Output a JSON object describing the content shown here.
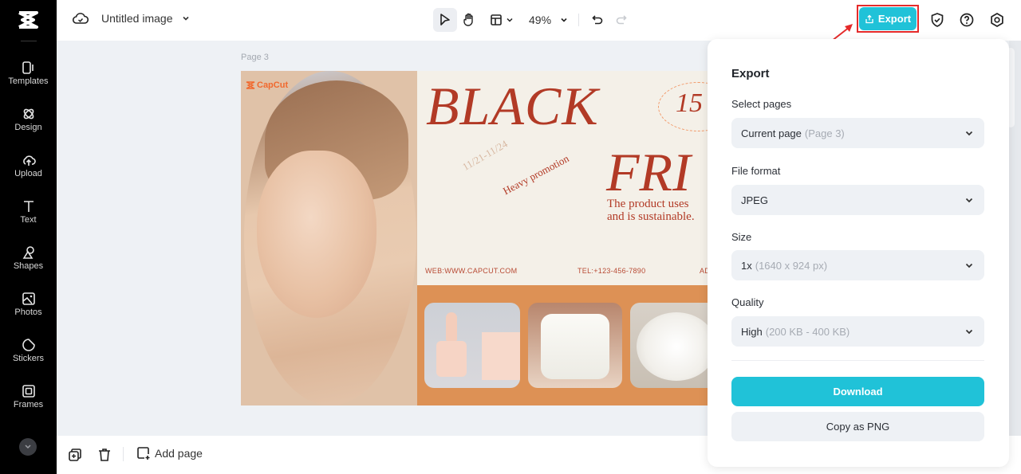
{
  "app": {
    "title": "Untitled image",
    "zoom": "49%"
  },
  "sidebar": {
    "items": [
      {
        "label": "Templates",
        "icon": "templates-icon"
      },
      {
        "label": "Design",
        "icon": "design-icon"
      },
      {
        "label": "Upload",
        "icon": "upload-icon"
      },
      {
        "label": "Text",
        "icon": "text-icon"
      },
      {
        "label": "Shapes",
        "icon": "shapes-icon"
      },
      {
        "label": "Photos",
        "icon": "photos-icon"
      },
      {
        "label": "Stickers",
        "icon": "stickers-icon"
      },
      {
        "label": "Frames",
        "icon": "frames-icon"
      }
    ]
  },
  "toolbar": {
    "export_label": "Export",
    "accent": "#20c2d8"
  },
  "canvas": {
    "page_label": "Page 3",
    "design": {
      "brand": "CapCut",
      "headline_1": "BLACK",
      "headline_2": "FRI",
      "badge": "15",
      "date": "11/21-11/24",
      "promo": "Heavy promotion",
      "tagline_1": "The product uses",
      "tagline_2": "and is sustainable.",
      "web": "WEB:WWW.CAPCUT.COM",
      "tel": "TEL:+123-456-7890",
      "addr": "AD"
    }
  },
  "bottom_bar": {
    "add_page_label": "Add page"
  },
  "export_panel": {
    "title": "Export",
    "select_pages": {
      "label": "Select pages",
      "value": "Current page",
      "hint": "(Page 3)"
    },
    "file_format": {
      "label": "File format",
      "value": "JPEG",
      "hint": ""
    },
    "size": {
      "label": "Size",
      "value": "1x",
      "hint": "(1640 x 924 px)"
    },
    "quality": {
      "label": "Quality",
      "value": "High",
      "hint": "(200 KB - 400 KB)"
    },
    "download_label": "Download",
    "copy_label": "Copy as PNG"
  }
}
